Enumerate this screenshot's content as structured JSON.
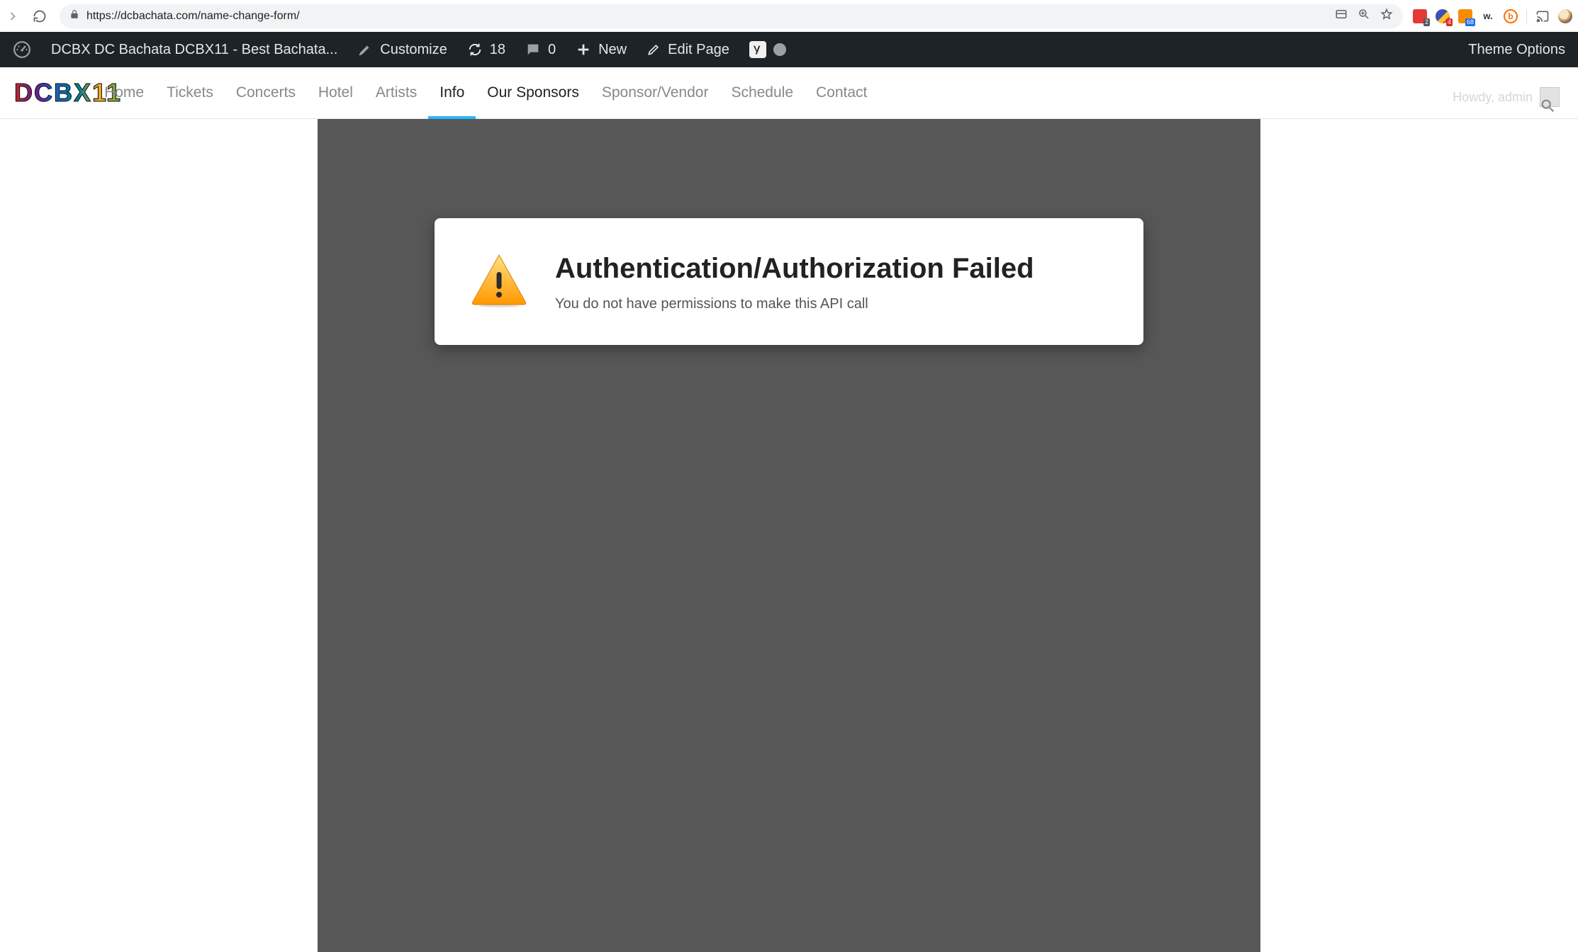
{
  "browser": {
    "url": "https://dcbachata.com/name-change-form/",
    "extensions": [
      {
        "name": "lastpass",
        "badge": "2",
        "style": "red"
      },
      {
        "name": "google-apps",
        "badge": "4",
        "style": "gradient"
      },
      {
        "name": "moz",
        "badge": "68",
        "style": "orange"
      },
      {
        "name": "wappalyzer",
        "label": "w.",
        "style": "w"
      },
      {
        "name": "bitly",
        "label": "b",
        "style": "circle"
      }
    ]
  },
  "adminbar": {
    "site_title": "DCBX DC Bachata DCBX11 - Best Bachata...",
    "customize": "Customize",
    "updates": "18",
    "comments": "0",
    "new": "New",
    "edit_page": "Edit Page",
    "theme_options": "Theme Options",
    "howdy": "Howdy, admin"
  },
  "nav": {
    "logo_text": "DCBX11",
    "items": [
      {
        "label": "Home",
        "active": false
      },
      {
        "label": "Tickets",
        "active": false
      },
      {
        "label": "Concerts",
        "active": false
      },
      {
        "label": "Hotel",
        "active": false
      },
      {
        "label": "Artists",
        "active": false
      },
      {
        "label": "Info",
        "active": true,
        "underline": true
      },
      {
        "label": "Our Sponsors",
        "active": true
      },
      {
        "label": "Sponsor/Vendor",
        "active": false
      },
      {
        "label": "Schedule",
        "active": false
      },
      {
        "label": "Contact",
        "active": false
      }
    ]
  },
  "error": {
    "title": "Authentication/Authorization Failed",
    "message": "You do not have permissions to make this API call"
  }
}
